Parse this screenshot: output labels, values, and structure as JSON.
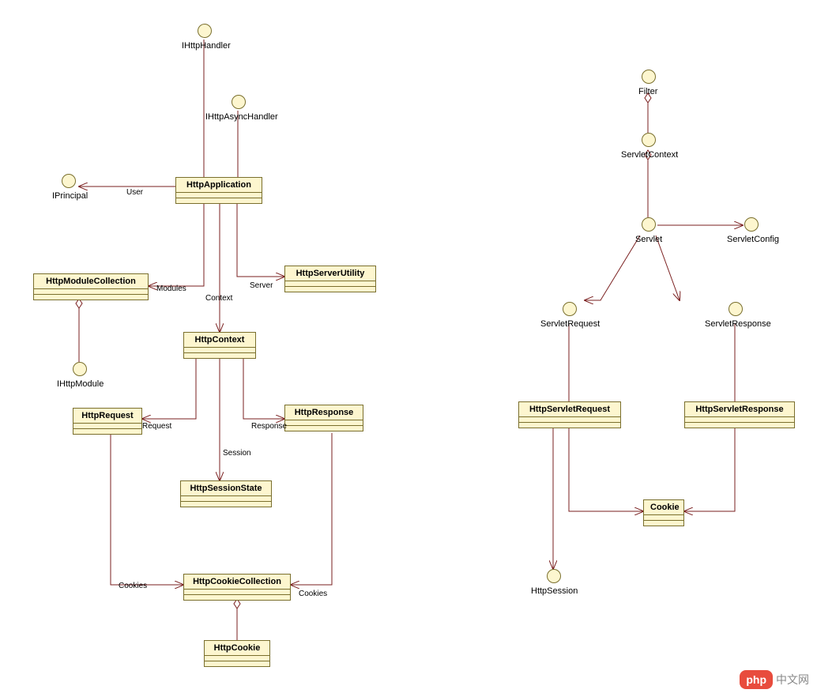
{
  "interfaces": {
    "ihttphandler": "IHttpHandler",
    "ihttpasynchandler": "IHttpAsyncHandler",
    "iprincipal": "IPrincipal",
    "ihttpmodule": "IHttpModule",
    "filter": "Filter",
    "servletcontext": "ServletContext",
    "servlet": "Servlet",
    "servletconfig": "ServletConfig",
    "servletrequest": "ServletRequest",
    "servletresponse": "ServletResponse",
    "httpsession": "HttpSession"
  },
  "classes": {
    "httpapplication": "HttpApplication",
    "httpmodulecollection": "HttpModuleCollection",
    "httpserverutility": "HttpServerUtility",
    "httpcontext": "HttpContext",
    "httprequest": "HttpRequest",
    "httpresponse": "HttpResponse",
    "httpsessionstate": "HttpSessionState",
    "httpcookiecollection": "HttpCookieCollection",
    "httpcookie": "HttpCookie",
    "httpservletrequest": "HttpServletRequest",
    "httpservletresponse": "HttpServletResponse",
    "cookie": "Cookie"
  },
  "edges": {
    "user": "User",
    "modules": "Modules",
    "context": "Context",
    "server": "Server",
    "request": "Request",
    "response": "Response",
    "session": "Session",
    "cookies1": "Cookies",
    "cookies2": "Cookies"
  },
  "watermark": {
    "logo": "php",
    "text": "中文网"
  }
}
